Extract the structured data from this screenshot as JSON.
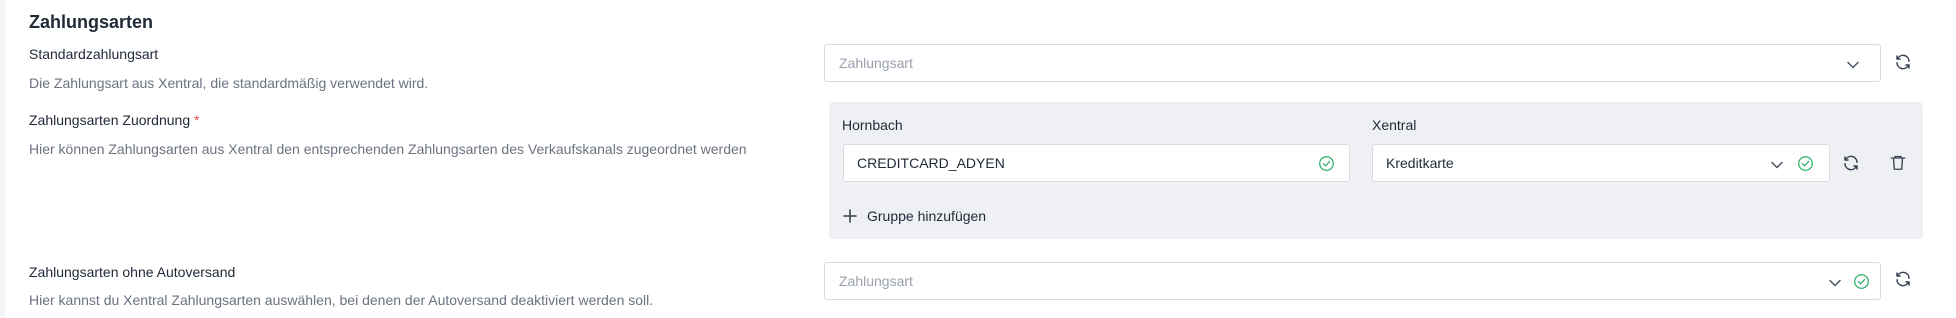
{
  "section": {
    "title": "Zahlungsarten"
  },
  "standard": {
    "label": "Standardzahlungsart",
    "description": "Die Zahlungsart aus Xentral, die standardmäßig verwendet wird.",
    "placeholder": "Zahlungsart"
  },
  "mapping": {
    "label": "Zahlungsarten Zuordnung",
    "required_mark": "*",
    "description": "Hier können Zahlungsarten aus Xentral den entsprechenden Zahlungsarten des Verkaufskanals zugeordnet werden",
    "column_left": "Hornbach",
    "column_right": "Xentral",
    "rows": [
      {
        "left_value": "CREDITCARD_ADYEN",
        "right_value": "Kreditkarte"
      }
    ],
    "add_group_label": "Gruppe hinzufügen"
  },
  "no_autoshipping": {
    "label": "Zahlungsarten ohne Autoversand",
    "description": "Hier kannst du Xentral Zahlungsarten auswählen, bei denen der Autoversand deaktiviert werden soll.",
    "placeholder": "Zahlungsart"
  },
  "colors": {
    "valid_green": "#2fb26a",
    "required_red": "#e04b4b",
    "border": "#d7dbe2",
    "mapping_bg": "#eef0f3"
  },
  "icons": [
    "chevron-down-icon",
    "check-circle-icon",
    "refresh-icon",
    "trash-icon",
    "plus-icon"
  ]
}
